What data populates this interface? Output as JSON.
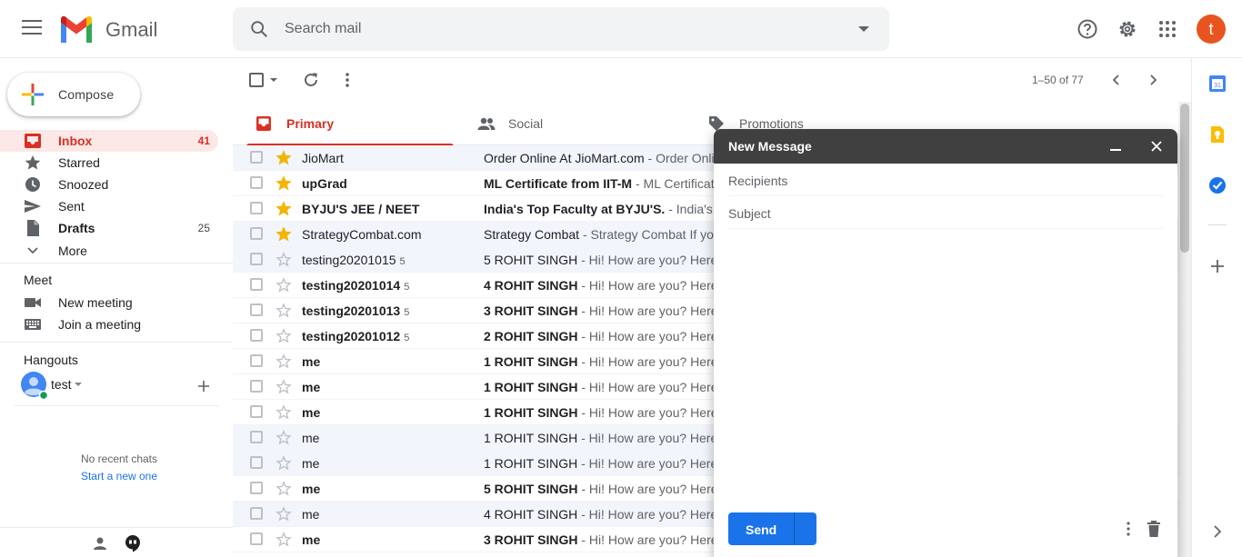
{
  "header": {
    "app_name": "Gmail",
    "search_placeholder": "Search mail",
    "avatar_letter": "t"
  },
  "sidebar": {
    "compose_label": "Compose",
    "items": [
      {
        "label": "Inbox",
        "count": "41",
        "icon": "inbox-icon"
      },
      {
        "label": "Starred",
        "count": "",
        "icon": "star-icon"
      },
      {
        "label": "Snoozed",
        "count": "",
        "icon": "clock-icon"
      },
      {
        "label": "Sent",
        "count": "",
        "icon": "send-icon"
      },
      {
        "label": "Drafts",
        "count": "25",
        "icon": "draft-icon"
      },
      {
        "label": "More",
        "count": "",
        "icon": "chevron-down-icon"
      }
    ],
    "meet": {
      "title": "Meet",
      "new_meeting": "New meeting",
      "join_meeting": "Join a meeting"
    },
    "hangouts": {
      "title": "Hangouts",
      "user": "test",
      "no_chats": "No recent chats",
      "start_new": "Start a new one"
    }
  },
  "toolbar": {
    "pager": "1–50 of 77"
  },
  "tabs": [
    {
      "label": "Primary",
      "icon": "inbox-icon"
    },
    {
      "label": "Social",
      "icon": "people-icon"
    },
    {
      "label": "Promotions",
      "icon": "tag-icon"
    }
  ],
  "emails": [
    {
      "sender": "JioMart",
      "count": "",
      "subject": "Order Online At JioMart.com",
      "snippet": " - Order Online At JioMart.com",
      "unread": false,
      "starred": true
    },
    {
      "sender": "upGrad",
      "count": "",
      "subject": "ML Certificate from IIT-M",
      "snippet": " - ML Certificate from IIT-M",
      "unread": true,
      "starred": true
    },
    {
      "sender": "BYJU'S JEE / NEET",
      "count": "",
      "subject": "India's Top Faculty at BYJU'S.",
      "snippet": " - India's Top Faculty",
      "unread": true,
      "starred": true
    },
    {
      "sender": "StrategyCombat.com",
      "count": "",
      "subject": "Strategy Combat",
      "snippet": " - Strategy Combat If you",
      "unread": false,
      "starred": true
    },
    {
      "sender": "testing20201015",
      "count": "5",
      "subject": "5 ROHIT SINGH",
      "snippet": " - Hi! How are you? Here",
      "unread": false,
      "starred": false
    },
    {
      "sender": "testing20201014",
      "count": "5",
      "subject": "4 ROHIT SINGH",
      "snippet": " - Hi! How are you? Here",
      "unread": true,
      "starred": false
    },
    {
      "sender": "testing20201013",
      "count": "5",
      "subject": "3 ROHIT SINGH",
      "snippet": " - Hi! How are you? Here",
      "unread": true,
      "starred": false
    },
    {
      "sender": "testing20201012",
      "count": "5",
      "subject": "2 ROHIT SINGH",
      "snippet": " - Hi! How are you? Here",
      "unread": true,
      "starred": false
    },
    {
      "sender": "me",
      "count": "",
      "subject": "1 ROHIT SINGH",
      "snippet": " - Hi! How are you? Here",
      "unread": true,
      "starred": false
    },
    {
      "sender": "me",
      "count": "",
      "subject": "1 ROHIT SINGH",
      "snippet": " - Hi! How are you? Here",
      "unread": true,
      "starred": false
    },
    {
      "sender": "me",
      "count": "",
      "subject": "1 ROHIT SINGH",
      "snippet": " - Hi! How are you? Here",
      "unread": true,
      "starred": false
    },
    {
      "sender": "me",
      "count": "",
      "subject": "1 ROHIT SINGH",
      "snippet": " - Hi! How are you? Here",
      "unread": false,
      "starred": false
    },
    {
      "sender": "me",
      "count": "",
      "subject": "1 ROHIT SINGH",
      "snippet": " - Hi! How are you? Here",
      "unread": false,
      "starred": false
    },
    {
      "sender": "me",
      "count": "",
      "subject": "5 ROHIT SINGH",
      "snippet": " - Hi! How are you? Here",
      "unread": true,
      "starred": false
    },
    {
      "sender": "me",
      "count": "",
      "subject": "4 ROHIT SINGH",
      "snippet": " - Hi! How are you? Here",
      "unread": false,
      "starred": false
    },
    {
      "sender": "me",
      "count": "",
      "subject": "3 ROHIT SINGH",
      "snippet": " - Hi! How are you? Here",
      "unread": true,
      "starred": false
    }
  ],
  "compose_window": {
    "title": "New Message",
    "recipients_placeholder": "Recipients",
    "subject_placeholder": "Subject",
    "send_label": "Send"
  },
  "colors": {
    "accent_red": "#d93025",
    "send_blue": "#1a73e8",
    "star_yellow": "#f4b400"
  }
}
